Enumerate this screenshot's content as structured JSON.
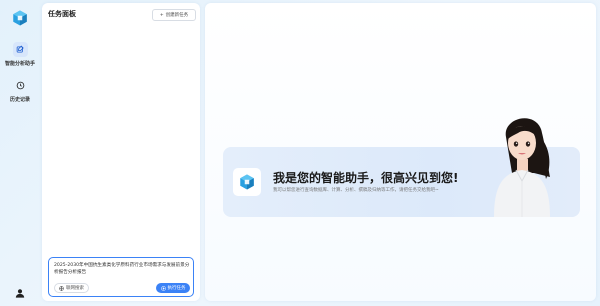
{
  "rail": {
    "items": [
      {
        "label": "智能分析助手",
        "icon": "chat-edit-icon",
        "active": true
      },
      {
        "label": "历史记录",
        "icon": "history-icon",
        "active": false
      }
    ],
    "user_icon": "user-icon"
  },
  "panel": {
    "title": "任务面板",
    "new_task_label": "创建新任务",
    "input_value": "2025-2030年中国抗生素类化学原料药行业市场需求与发展前景分析报告分析报告",
    "web_search_label": "联网搜索",
    "run_label": "执行任务"
  },
  "main": {
    "welcome_title": "我是您的智能助手，很高兴见到您!",
    "welcome_sub": "我可以帮您进行查询数据库、计算、分析、撰稿及归纳等工作，请把任务交给我吧~"
  },
  "colors": {
    "accent": "#3b82f6",
    "brand_logo": "#2aa0e0"
  }
}
